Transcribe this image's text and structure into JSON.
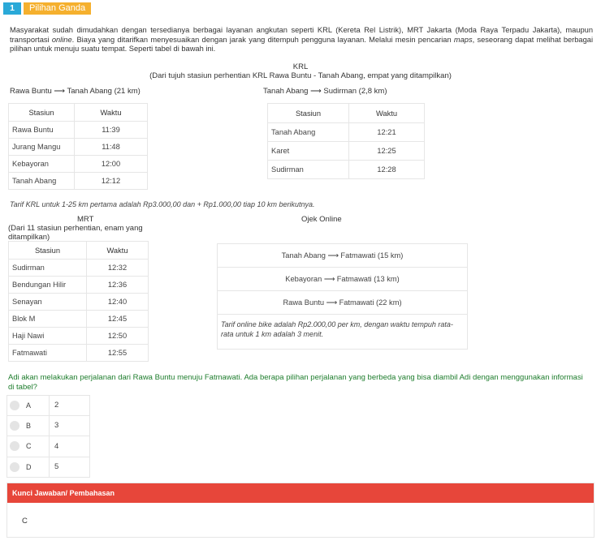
{
  "header": {
    "number": "1",
    "type": "Pilihan Ganda"
  },
  "intro": {
    "p1": "Masyarakat sudah dimudahkan dengan tersedianya berbagai layanan angkutan seperti KRL (Kereta Rel Listrik), MRT Jakarta (Moda Raya Terpadu Jakarta), maupun transportasi ",
    "em1": "online",
    "p2": ". Biaya yang ditarifkan menyesuaikan dengan jarak yang ditempuh pengguna layanan. Melalui mesin pencarian ",
    "em2": "maps",
    "p3": ", seseorang dapat melihat berbagai pilihan untuk menuju suatu tempat. Seperti tabel di bawah ini."
  },
  "krl": {
    "title": "KRL",
    "subtitle": "(Dari tujuh stasiun perhentian KRL Rawa Buntu - Tanah Abang, empat yang ditampilkan)",
    "route1": "Rawa Buntu ⟶ Tanah Abang (21 km)",
    "route2": "Tanah Abang ⟶ Sudirman (2,8 km)",
    "col_station": "Stasiun",
    "col_time": "Waktu",
    "table1": [
      {
        "station": "Rawa Buntu",
        "time": "11:39"
      },
      {
        "station": "Jurang Mangu",
        "time": "11:48"
      },
      {
        "station": "Kebayoran",
        "time": "12:00"
      },
      {
        "station": "Tanah Abang",
        "time": "12:12"
      }
    ],
    "table2": [
      {
        "station": "Tanah Abang",
        "time": "12:21"
      },
      {
        "station": "Karet",
        "time": "12:25"
      },
      {
        "station": "Sudirman",
        "time": "12:28"
      }
    ],
    "fare": "Tarif KRL untuk 1-25 km pertama adalah Rp3.000,00 dan + Rp1.000,00 tiap 10 km berikutnya."
  },
  "mrt": {
    "title": "MRT",
    "subtitle": "(Dari 11 stasiun perhentian, enam yang ditampilkan)",
    "col_station": "Stasiun",
    "col_time": "Waktu",
    "rows": [
      {
        "station": "Sudirman",
        "time": "12:32"
      },
      {
        "station": "Bendungan Hilir",
        "time": "12:36"
      },
      {
        "station": "Senayan",
        "time": "12:40"
      },
      {
        "station": "Blok M",
        "time": "12:45"
      },
      {
        "station": "Haji Nawi",
        "time": "12:50"
      },
      {
        "station": "Fatmawati",
        "time": "12:55"
      }
    ]
  },
  "ojek": {
    "title": "Ojek Online",
    "routes": [
      "Tanah Abang ⟶ Fatmawati (15 km)",
      "Kebayoran ⟶ Fatmawati (13 km)",
      "Rawa Buntu ⟶ Fatmawati (22 km)"
    ],
    "fare": "Tarif online bike adalah Rp2.000,00 per km, dengan waktu tempuh rata-rata untuk 1 km adalah 3 menit."
  },
  "question": "Adi akan melakukan perjalanan dari Rawa Buntu menuju Fatmawati. Ada berapa pilihan perjalanan yang berbeda yang bisa diambil Adi dengan menggunakan informasi di tabel?",
  "options": [
    {
      "letter": "A",
      "value": "2"
    },
    {
      "letter": "B",
      "value": "3"
    },
    {
      "letter": "C",
      "value": "4"
    },
    {
      "letter": "D",
      "value": "5"
    }
  ],
  "answer": {
    "heading": "Kunci Jawaban/ Pembahasan",
    "value": "C"
  },
  "colors": {
    "number_badge": "#2aa9d8",
    "type_badge": "#f5b02e",
    "question": "#1e7d2d",
    "answer_header": "#e7463a"
  }
}
